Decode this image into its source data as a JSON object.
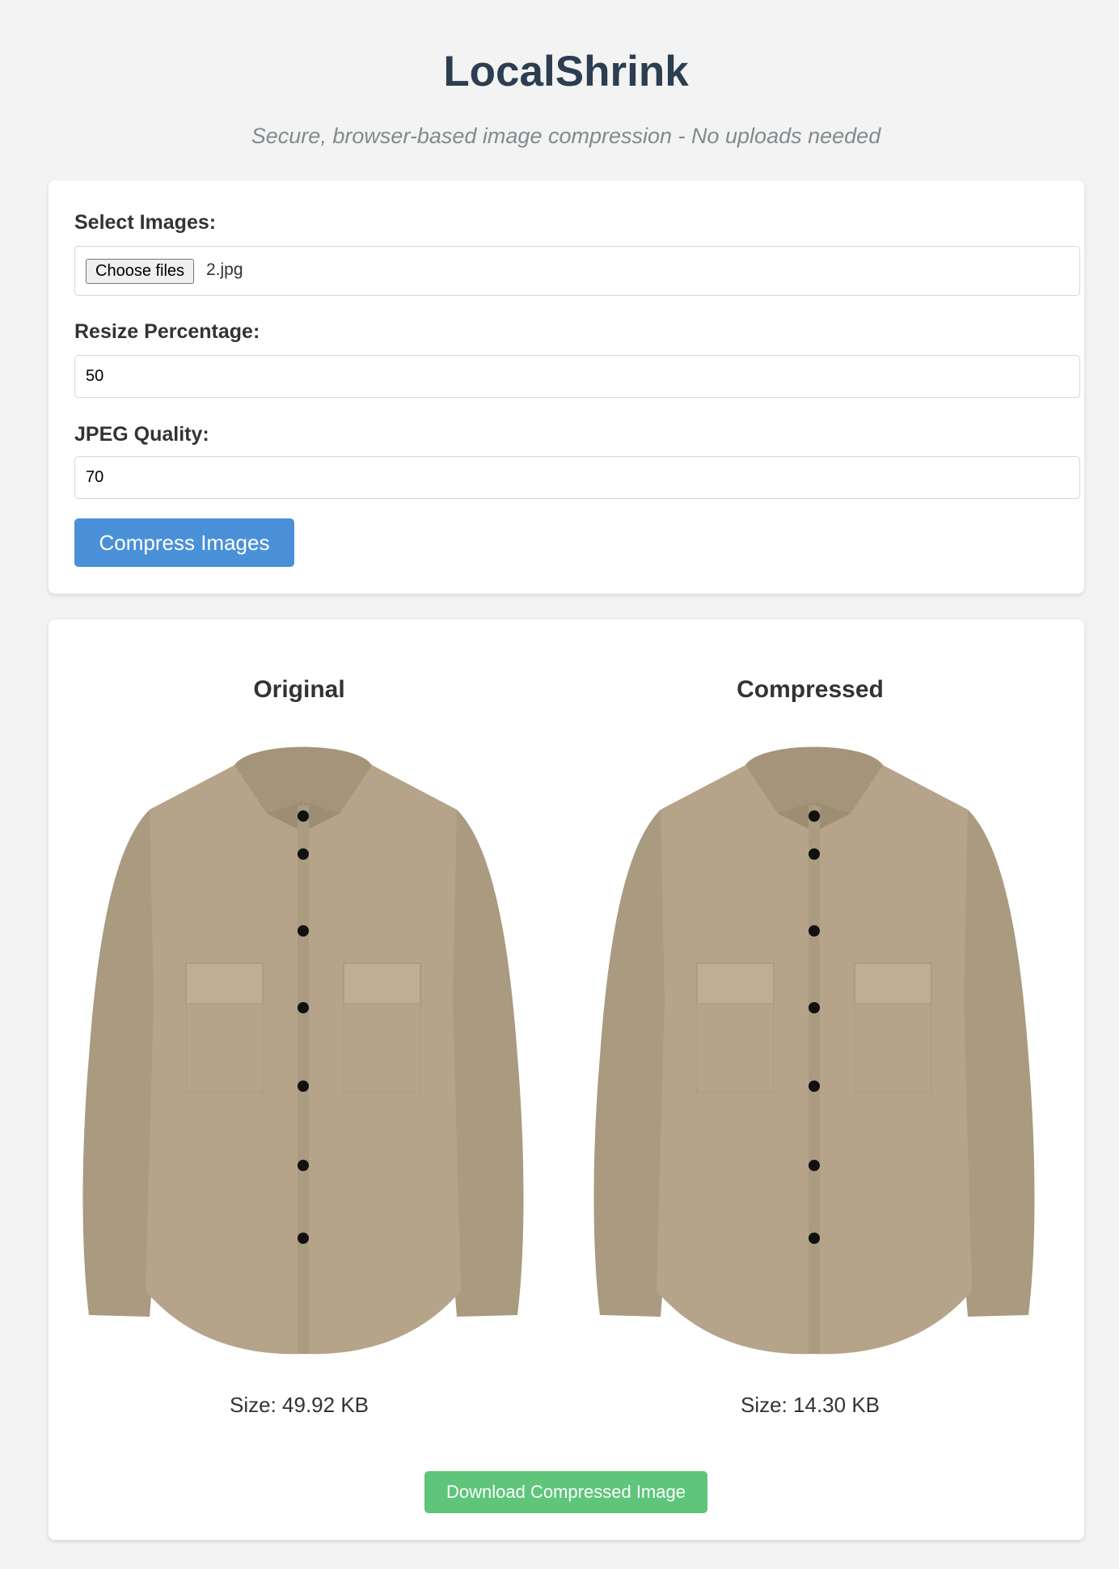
{
  "header": {
    "title": "LocalShrink",
    "subtitle": "Secure, browser-based image compression - No uploads needed"
  },
  "form": {
    "select_label": "Select Images:",
    "file_button_label": "Choose files",
    "file_name": "2.jpg",
    "resize_label": "Resize Percentage:",
    "resize_value": "50",
    "quality_label": "JPEG Quality:",
    "quality_value": "70",
    "compress_button": "Compress Images"
  },
  "results": {
    "original": {
      "title": "Original",
      "size": "Size: 49.92 KB"
    },
    "compressed": {
      "title": "Compressed",
      "size": "Size: 14.30 KB"
    },
    "download_button": "Download Compressed Image"
  },
  "colors": {
    "primary": "#4a90d9",
    "success": "#5ec57a",
    "title": "#2c3e50",
    "subtitle": "#7f8c8d",
    "shirt": "#b5a48a"
  }
}
